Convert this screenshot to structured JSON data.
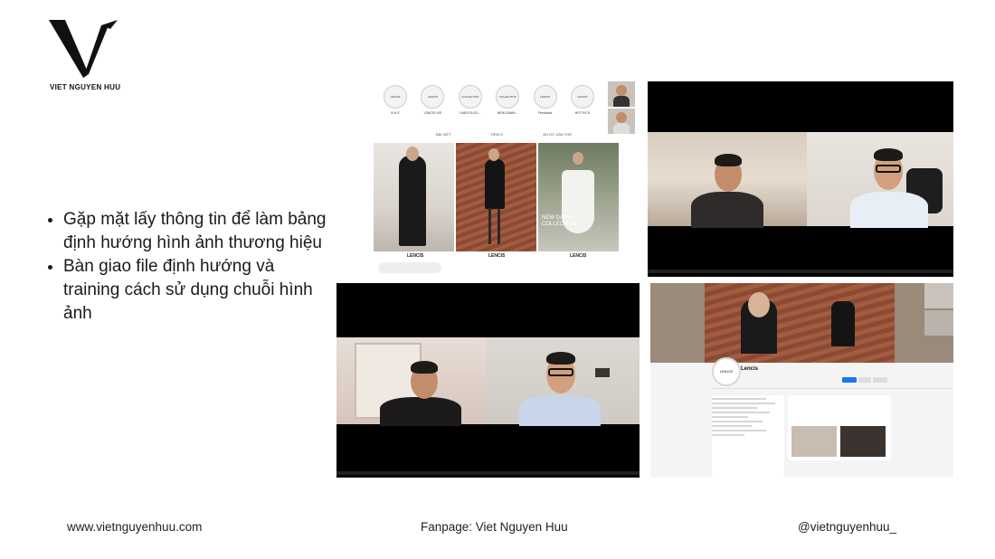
{
  "brand": {
    "name": "VIET NGUYEN HUU"
  },
  "bullets": [
    "Gặp mặt lấy thông tin để làm bảng định hướng hình ảnh thương hiệu",
    "Bàn giao file định hướng và training cách sử dụng chuỗi hình ảnh"
  ],
  "footer": {
    "website": "www.vietnguyenhuu.com",
    "fanpage": "Fanpage: Viet Nguyen Huu",
    "handle": "@vietnguyenhuu_"
  },
  "screens": {
    "instagram": {
      "highlights": [
        {
          "circle": "LENCIS",
          "label": "B H S"
        },
        {
          "circle": "LENCIS",
          "label": "LENCIS VID"
        },
        {
          "circle": "COLLECTION",
          "label": "LINES ELEG..."
        },
        {
          "circle": "COLLECTION",
          "label": "NEW DAWN..."
        },
        {
          "circle": "LENCIS",
          "label": "Feedback"
        },
        {
          "circle": "LENCIS",
          "label": "HOT PICK"
        }
      ],
      "tabs": [
        "BÀI VIẾT",
        "REELS",
        "ĐƯỢC GẮN THẺ"
      ],
      "post_labels": [
        "LENCIS",
        "LENCIS",
        "LENCIS"
      ],
      "overlay_text": "NEW DAWN COLLECTION"
    },
    "facebook": {
      "page_name": "Lencis",
      "avatar_text": "LENCIS"
    }
  }
}
